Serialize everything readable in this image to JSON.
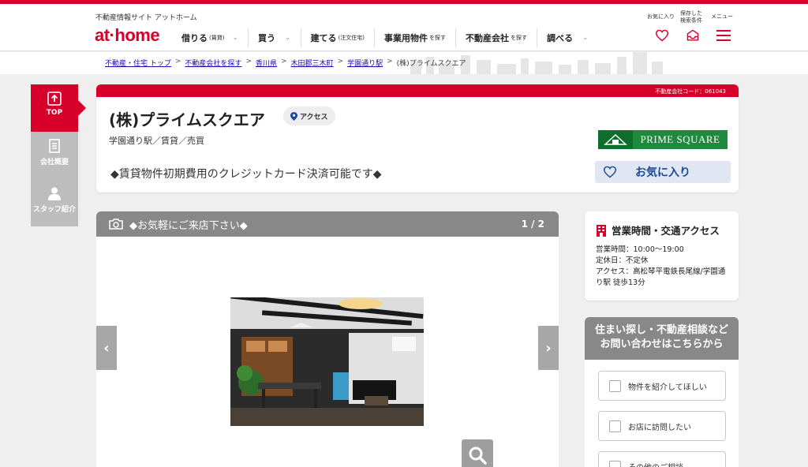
{
  "header": {
    "tagline": "不動産情報サイト アットホーム",
    "logo": "at·home",
    "nav": [
      {
        "label": "借りる",
        "sub": "(賃貸)"
      },
      {
        "label": "買う",
        "sub": ""
      },
      {
        "label": "建てる",
        "sub": "(注文住宅)"
      },
      {
        "label": "事業用物件",
        "sub": "を探す"
      },
      {
        "label": "不動産会社",
        "sub": "を探す"
      },
      {
        "label": "調べる",
        "sub": ""
      }
    ],
    "util": {
      "favorites": "お気に入り",
      "saved_line1": "保存した",
      "saved_line2": "検索条件",
      "menu": "メニュー"
    }
  },
  "breadcrumb": [
    "不動産・住宅 トップ",
    "不動産会社を探す",
    "香川県",
    "木田郡三木町",
    "学園通り駅",
    "(株)プライムスクエア"
  ],
  "sidetabs": [
    {
      "label": "TOP",
      "icon": "arrow-up-icon"
    },
    {
      "label": "会社概要",
      "icon": "document-icon"
    },
    {
      "label": "スタッフ紹介",
      "icon": "person-icon"
    }
  ],
  "company": {
    "code": "不動産会社コード：061043",
    "name": "(株)プライムスクエア",
    "access_chip": "アクセス",
    "subline": "学園通り駅／賃貸／売買",
    "catch": "◆賃貸物件初期費用のクレジットカード決済可能です◆",
    "brand": "PRIME SQUARE",
    "favorite_label": "お気に入り"
  },
  "gallery": {
    "title": "◆お気軽にご来店下さい◆",
    "count": "1 / 2",
    "prev": "‹",
    "next": "›"
  },
  "hours": {
    "title": "営業時間・交通アクセス",
    "business": "営業時間：10:00〜19:00",
    "holiday": "定休日：不定休",
    "access": "アクセス：高松琴平電鉄長尾線/学園通り駅 徒歩13分"
  },
  "contact": {
    "line1": "住まい探し・不動産相談など",
    "line2": "お問い合わせはこちらから",
    "options": [
      "物件を紹介してほしい",
      "お店に訪問したい",
      "その他のご相談"
    ]
  },
  "colors": {
    "brand_red": "#d6002a",
    "gray_panel": "#888888",
    "prime_green": "#1f8a3d"
  }
}
